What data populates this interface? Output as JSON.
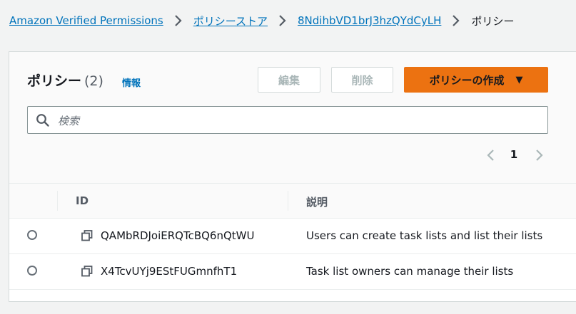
{
  "breadcrumb": {
    "items": [
      {
        "label": "Amazon Verified Permissions"
      },
      {
        "label": "ポリシーストア"
      },
      {
        "label": "8NdihbVD1brJ3hzQYdCyLH"
      }
    ],
    "current": "ポリシー"
  },
  "panel": {
    "title": "ポリシー",
    "count": "(2)",
    "info_link": "情報",
    "edit_button": "編集",
    "delete_button": "削除",
    "create_button": "ポリシーの作成",
    "create_caret": "▼"
  },
  "search": {
    "placeholder": "検索",
    "value": ""
  },
  "pagination": {
    "current_page": "1"
  },
  "table": {
    "headers": [
      "ID",
      "説明"
    ],
    "rows": [
      {
        "id": "QAMbRDJoiERQTcBQ6nQtWU",
        "description": "Users can create task lists and list their lists"
      },
      {
        "id": "X4TcvUYj9EStFUGmnfhT1",
        "description": "Task list owners can manage their lists"
      }
    ]
  },
  "colors": {
    "link": "#0073bb",
    "primary_button": "#ec7211",
    "background": "#f2f3f3",
    "disabled_text": "#aab7b8"
  },
  "icons": [
    "chevron-right-icon",
    "search-icon",
    "chevron-left-icon",
    "copy-icon",
    "radio-button"
  ]
}
